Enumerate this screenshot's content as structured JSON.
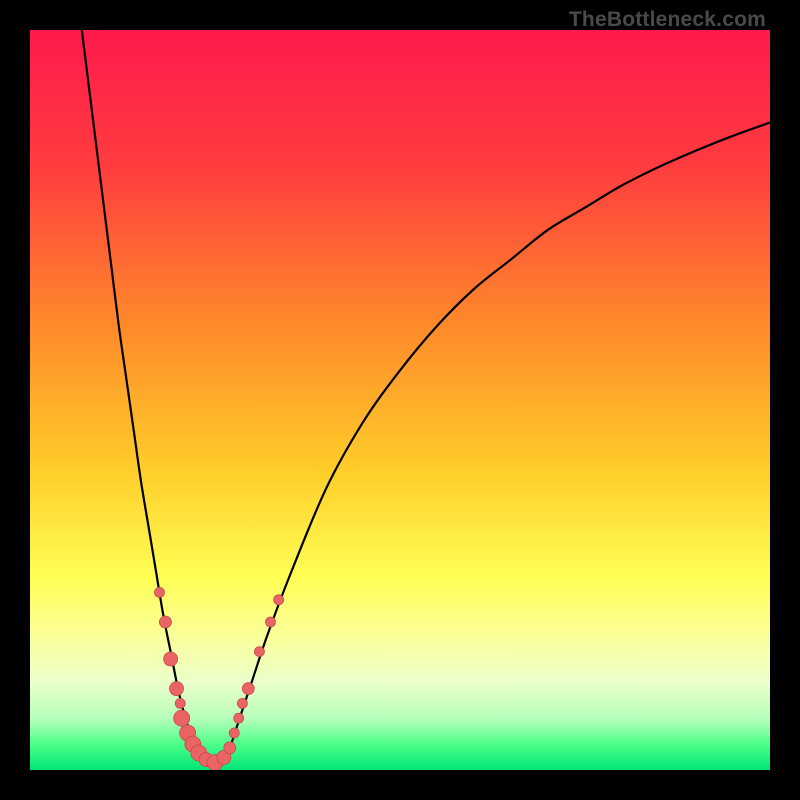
{
  "watermark": "TheBottleneck.com",
  "colors": {
    "frame_bg": "#000000",
    "watermark_text": "#4a4a4a",
    "curve_stroke": "#000000",
    "marker_fill": "#eb6464",
    "marker_stroke": "#c24d4d",
    "gradient_stops": [
      {
        "offset": 0.0,
        "color": "#ff1a4d"
      },
      {
        "offset": 0.18,
        "color": "#ff3b3f"
      },
      {
        "offset": 0.4,
        "color": "#ff8a2a"
      },
      {
        "offset": 0.6,
        "color": "#ffcf2a"
      },
      {
        "offset": 0.74,
        "color": "#ffff55"
      },
      {
        "offset": 0.82,
        "color": "#fbff9a"
      },
      {
        "offset": 0.88,
        "color": "#ecffca"
      },
      {
        "offset": 0.93,
        "color": "#b8ffba"
      },
      {
        "offset": 0.965,
        "color": "#4dff8a"
      },
      {
        "offset": 1.0,
        "color": "#00e676"
      }
    ]
  },
  "chart_data": {
    "type": "line",
    "title": "",
    "xlabel": "",
    "ylabel": "",
    "xlim": [
      0,
      100
    ],
    "ylim": [
      0,
      100
    ],
    "series": [
      {
        "name": "bottleneck-curve",
        "x": [
          7,
          8,
          9,
          10,
          11,
          12,
          13,
          14,
          15,
          16,
          17,
          18,
          19,
          20,
          21,
          22,
          23,
          24,
          25,
          26,
          27,
          28,
          30,
          32,
          35,
          40,
          45,
          50,
          55,
          60,
          65,
          70,
          75,
          80,
          85,
          90,
          95,
          100
        ],
        "y": [
          100,
          92,
          84,
          76,
          68,
          60,
          53,
          46,
          39,
          33,
          27,
          21,
          16,
          11,
          7,
          4,
          2,
          1,
          0.5,
          1,
          3,
          6,
          12,
          18,
          26,
          38,
          47,
          54,
          60,
          65,
          69,
          73,
          76,
          79,
          81.5,
          83.7,
          85.7,
          87.5
        ]
      }
    ],
    "markers": [
      {
        "x": 17.5,
        "y": 24,
        "r": 5
      },
      {
        "x": 18.3,
        "y": 20,
        "r": 6
      },
      {
        "x": 19.0,
        "y": 15,
        "r": 7
      },
      {
        "x": 19.8,
        "y": 11,
        "r": 7
      },
      {
        "x": 20.3,
        "y": 9,
        "r": 5
      },
      {
        "x": 20.5,
        "y": 7,
        "r": 8
      },
      {
        "x": 21.3,
        "y": 5,
        "r": 8
      },
      {
        "x": 22.0,
        "y": 3.5,
        "r": 8
      },
      {
        "x": 22.8,
        "y": 2.3,
        "r": 8
      },
      {
        "x": 23.8,
        "y": 1.4,
        "r": 7
      },
      {
        "x": 25.0,
        "y": 1.0,
        "r": 8
      },
      {
        "x": 26.2,
        "y": 1.7,
        "r": 7
      },
      {
        "x": 27.0,
        "y": 3.0,
        "r": 6
      },
      {
        "x": 27.6,
        "y": 5.0,
        "r": 5
      },
      {
        "x": 28.2,
        "y": 7.0,
        "r": 5
      },
      {
        "x": 28.7,
        "y": 9.0,
        "r": 5
      },
      {
        "x": 29.5,
        "y": 11.0,
        "r": 6
      },
      {
        "x": 31.0,
        "y": 16.0,
        "r": 5
      },
      {
        "x": 32.5,
        "y": 20.0,
        "r": 5
      },
      {
        "x": 33.6,
        "y": 23.0,
        "r": 5
      }
    ]
  }
}
